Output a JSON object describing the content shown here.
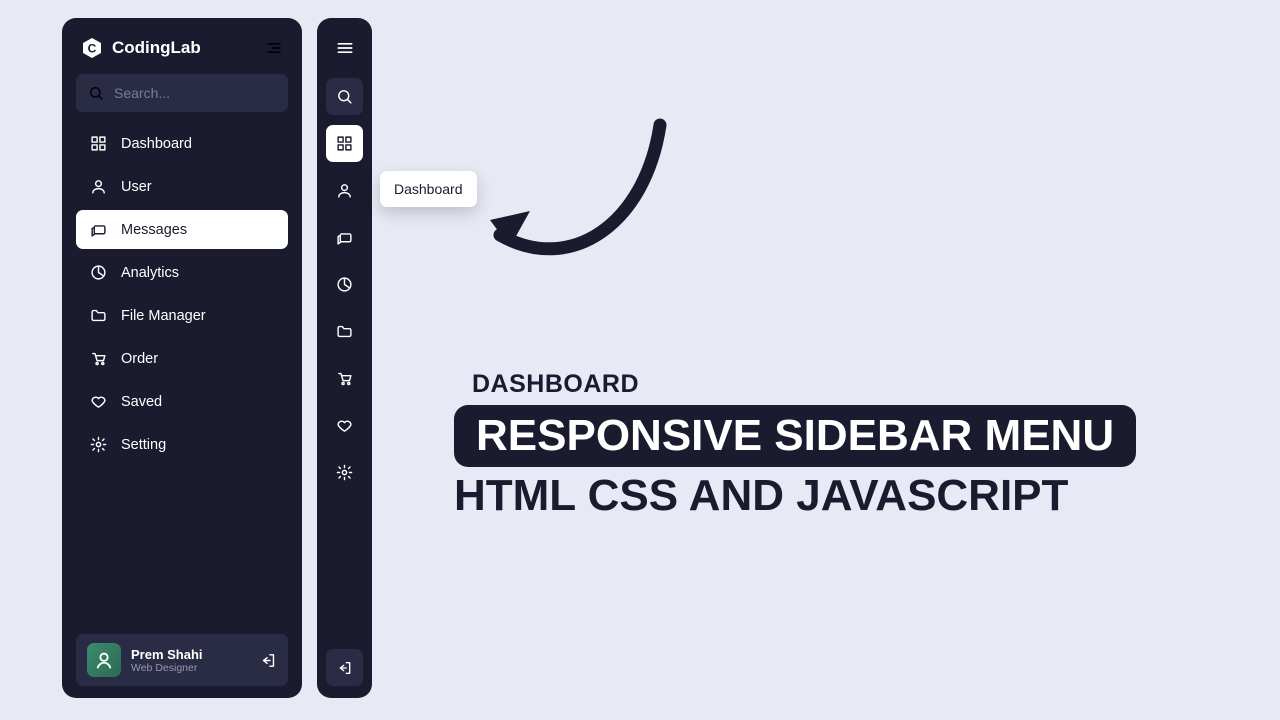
{
  "brand": {
    "name": "CodingLab"
  },
  "search": {
    "placeholder": "Search..."
  },
  "nav": {
    "items": [
      {
        "label": "Dashboard"
      },
      {
        "label": "User"
      },
      {
        "label": "Messages"
      },
      {
        "label": "Analytics"
      },
      {
        "label": "File Manager"
      },
      {
        "label": "Order"
      },
      {
        "label": "Saved"
      },
      {
        "label": "Setting"
      }
    ]
  },
  "user": {
    "name": "Prem Shahi",
    "role": "Web Designer"
  },
  "tooltip": {
    "label": "Dashboard"
  },
  "headline": {
    "kicker": "DASHBOARD",
    "pill": "RESPONSIVE SIDEBAR MENU",
    "sub": "HTML CSS AND JAVASCRIPT"
  }
}
